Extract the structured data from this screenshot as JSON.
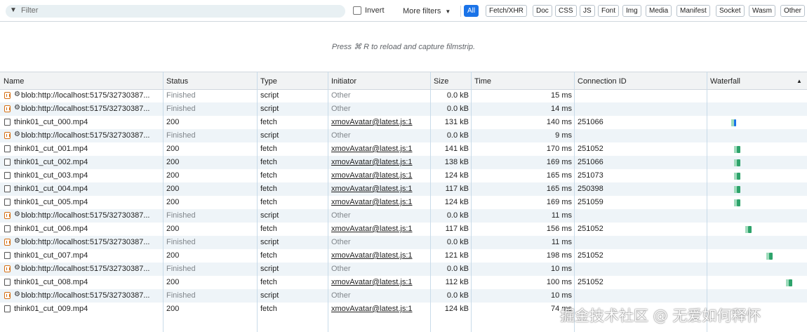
{
  "toolbar": {
    "filter_placeholder": "Filter",
    "filter_icon": "funnel-icon",
    "invert_label": "Invert",
    "more_filters_label": "More filters",
    "type_filters": [
      "All",
      "Fetch/XHR",
      "Doc",
      "CSS",
      "JS",
      "Font",
      "Img",
      "Media",
      "Manifest",
      "Socket",
      "Wasm",
      "Other"
    ],
    "active_filter": "All"
  },
  "filmstrip": {
    "hint": "Press ⌘ R to reload and capture filmstrip."
  },
  "columns": [
    "Name",
    "Status",
    "Type",
    "Initiator",
    "Size",
    "Time",
    "Connection ID",
    "Waterfall"
  ],
  "rows": [
    {
      "name": "blob:http://localhost:5175/32730387...",
      "status": "Finished",
      "type": "script",
      "initiator": "Other",
      "size": "0.0 kB",
      "time": "15 ms",
      "connection": "",
      "kind": "blob"
    },
    {
      "name": "blob:http://localhost:5175/32730387...",
      "status": "Finished",
      "type": "script",
      "initiator": "Other",
      "size": "0.0 kB",
      "time": "14 ms",
      "connection": "",
      "kind": "blob"
    },
    {
      "name": "think01_cut_000.mp4",
      "status": "200",
      "type": "fetch",
      "initiator": "xmovAvatar@latest.js:1",
      "size": "131 kB",
      "time": "140 ms",
      "connection": "251066",
      "kind": "media"
    },
    {
      "name": "blob:http://localhost:5175/32730387...",
      "status": "Finished",
      "type": "script",
      "initiator": "Other",
      "size": "0.0 kB",
      "time": "9 ms",
      "connection": "",
      "kind": "blob"
    },
    {
      "name": "think01_cut_001.mp4",
      "status": "200",
      "type": "fetch",
      "initiator": "xmovAvatar@latest.js:1",
      "size": "141 kB",
      "time": "170 ms",
      "connection": "251052",
      "kind": "media"
    },
    {
      "name": "think01_cut_002.mp4",
      "status": "200",
      "type": "fetch",
      "initiator": "xmovAvatar@latest.js:1",
      "size": "138 kB",
      "time": "169 ms",
      "connection": "251066",
      "kind": "media"
    },
    {
      "name": "think01_cut_003.mp4",
      "status": "200",
      "type": "fetch",
      "initiator": "xmovAvatar@latest.js:1",
      "size": "124 kB",
      "time": "165 ms",
      "connection": "251073",
      "kind": "media"
    },
    {
      "name": "think01_cut_004.mp4",
      "status": "200",
      "type": "fetch",
      "initiator": "xmovAvatar@latest.js:1",
      "size": "117 kB",
      "time": "165 ms",
      "connection": "250398",
      "kind": "media"
    },
    {
      "name": "think01_cut_005.mp4",
      "status": "200",
      "type": "fetch",
      "initiator": "xmovAvatar@latest.js:1",
      "size": "124 kB",
      "time": "169 ms",
      "connection": "251059",
      "kind": "media"
    },
    {
      "name": "blob:http://localhost:5175/32730387...",
      "status": "Finished",
      "type": "script",
      "initiator": "Other",
      "size": "0.0 kB",
      "time": "11 ms",
      "connection": "",
      "kind": "blob"
    },
    {
      "name": "think01_cut_006.mp4",
      "status": "200",
      "type": "fetch",
      "initiator": "xmovAvatar@latest.js:1",
      "size": "117 kB",
      "time": "156 ms",
      "connection": "251052",
      "kind": "media"
    },
    {
      "name": "blob:http://localhost:5175/32730387...",
      "status": "Finished",
      "type": "script",
      "initiator": "Other",
      "size": "0.0 kB",
      "time": "11 ms",
      "connection": "",
      "kind": "blob"
    },
    {
      "name": "think01_cut_007.mp4",
      "status": "200",
      "type": "fetch",
      "initiator": "xmovAvatar@latest.js:1",
      "size": "121 kB",
      "time": "198 ms",
      "connection": "251052",
      "kind": "media"
    },
    {
      "name": "blob:http://localhost:5175/32730387...",
      "status": "Finished",
      "type": "script",
      "initiator": "Other",
      "size": "0.0 kB",
      "time": "10 ms",
      "connection": "",
      "kind": "blob"
    },
    {
      "name": "think01_cut_008.mp4",
      "status": "200",
      "type": "fetch",
      "initiator": "xmovAvatar@latest.js:1",
      "size": "112 kB",
      "time": "100 ms",
      "connection": "251052",
      "kind": "media"
    },
    {
      "name": "blob:http://localhost:5175/32730387...",
      "status": "Finished",
      "type": "script",
      "initiator": "Other",
      "size": "0.0 kB",
      "time": "10 ms",
      "connection": "",
      "kind": "blob"
    },
    {
      "name": "think01_cut_009.mp4",
      "status": "200",
      "type": "fetch",
      "initiator": "xmovAvatar@latest.js:1",
      "size": "124 kB",
      "time": "74 ms",
      "connection": "",
      "kind": "media"
    }
  ],
  "watermark": "掘金技术社区 @ 无爱如何释怀",
  "colors": {
    "active_chip": "#1a73e8",
    "waterfall_bar": "#2ea36b",
    "row_alt": "#eef4f8"
  }
}
